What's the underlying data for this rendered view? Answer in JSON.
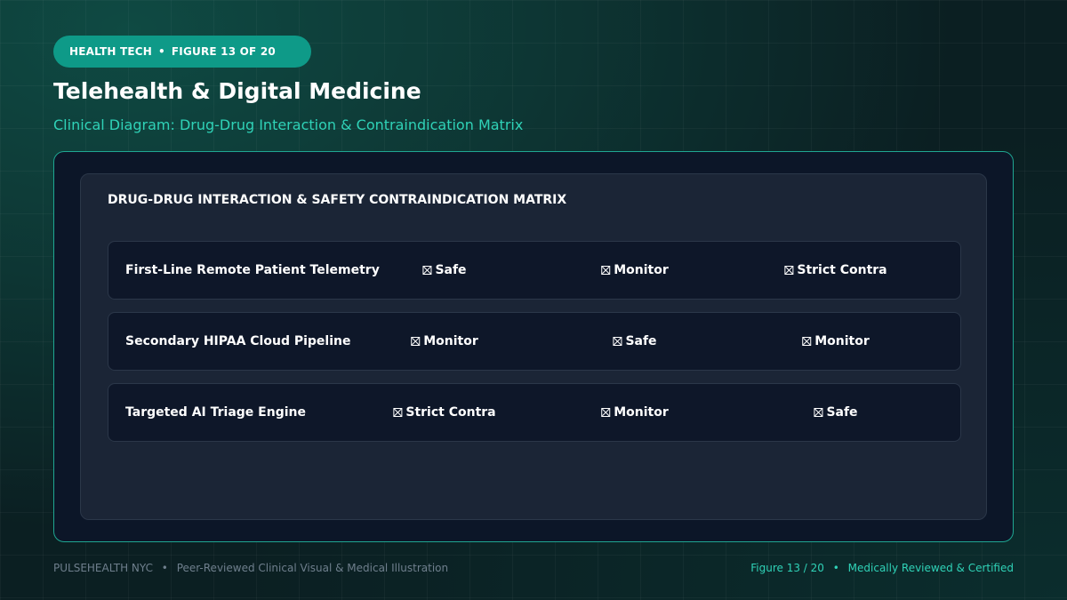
{
  "header": {
    "category": "HEALTH TECH",
    "figure_label": "FIGURE 13 OF 20",
    "title": "Telehealth & Digital Medicine",
    "subtitle": "Clinical Diagram: Drug-Drug Interaction & Contraindication Matrix"
  },
  "matrix": {
    "title": "DRUG-DRUG INTERACTION & SAFETY CONTRAINDICATION MATRIX",
    "rows": [
      {
        "label": "First-Line Remote Patient Telemetry",
        "cells": [
          "Safe",
          "Monitor",
          "Strict Contra"
        ]
      },
      {
        "label": "Secondary HIPAA Cloud Pipeline",
        "cells": [
          "Monitor",
          "Safe",
          "Monitor"
        ]
      },
      {
        "label": "Targeted AI Triage Engine",
        "cells": [
          "Strict Contra",
          "Monitor",
          "Safe"
        ]
      }
    ],
    "cell_icon": "boxed-x-icon"
  },
  "footer": {
    "brand": "PULSEHEALTH NYC",
    "tagline": "Peer-Reviewed Clinical Visual & Medical Illustration",
    "figure_count": "Figure 13 / 20",
    "certification": "Medically Reviewed & Certified"
  },
  "colors": {
    "accent": "#2fd2b7",
    "pill": "#0e9a88",
    "frame_border": "#1fa692",
    "background": "#0b1f22",
    "panel": "#1b2536",
    "row": "#0e1729"
  }
}
